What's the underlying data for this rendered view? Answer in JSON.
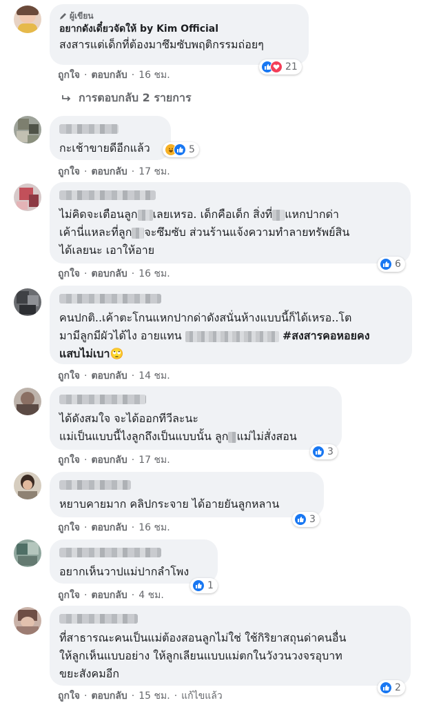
{
  "labels": {
    "like": "ถูกใจ",
    "reply": "ตอบกลับ",
    "dot": "·",
    "edited": "แก้ไขแล้ว"
  },
  "colors": {
    "like": "#1877f2",
    "love": "#f33e58",
    "haha": "#f7b125",
    "bubble": "#f0f2f5",
    "meta": "#65676b"
  },
  "comments": [
    {
      "badge": "ผู้เขียน",
      "author": "อยากดังเดี๋ยวจัดให้ by Kim Official",
      "text": "สงสารแต่เด็กที่ต้องมาซึมซับพฤติกรรมถ่อยๆ",
      "time": "16 ชม.",
      "reaction_icons": [
        "like-icon",
        "love-icon"
      ],
      "reaction_count": "21",
      "replies_label": "การตอบกลับ 2 รายการ"
    },
    {
      "text": "กะเช้าขายดีอีกแล้ว",
      "time": "17 ชม.",
      "reaction_icons": [
        "haha-icon",
        "like-icon"
      ],
      "reaction_count": "5"
    },
    {
      "line1_a": "ไม่คิดจะเตือนลูก",
      "line1_b": "เลยเหรอ. เด็กคือเด็ก สิ่งที่",
      "line1_c": "แหกปากด่า",
      "line2_a": "เค้านี่แหละที่ลูก",
      "line2_b": "จะซึมซับ ส่วนร้านแจ้งความทำลายทรัพย์สิน",
      "line3": "ได้เลยนะ เอาให้อาย",
      "time": "16 ชม.",
      "reaction_icons": [
        "like-icon"
      ],
      "reaction_count": "6"
    },
    {
      "line1": "คนปกติ..เค้าตะโกนแหกปากด่าดังสนั่นห้างแบบนี้ก็ได้เหรอ..โต",
      "line2_a": "มามีลูกมีผัวได้ไง อายแทน",
      "line2_tag": "#สงสารคอหอยคง",
      "line3": "แสบไม่เบา",
      "emoji": "🙄",
      "time": "14 ชม."
    },
    {
      "line1": "ได้ดังสมใจ จะได้ออกทีวีละนะ",
      "line2_a": "แม่เป็นแบบนี้ไงลูกถึงเป็นแบบนั้น ลูก",
      "line2_b": "แม่ไม่สั่งสอน",
      "time": "17 ชม.",
      "reaction_icons": [
        "like-icon"
      ],
      "reaction_count": "3"
    },
    {
      "text": "หยาบคายมาก คลิปกระจาย ได้อายยันลูกหลาน",
      "time": "16 ชม.",
      "reaction_icons": [
        "like-icon"
      ],
      "reaction_count": "3"
    },
    {
      "text": "อยากเห็นวาปแม่ปากลำโพง",
      "time": "4 ชม.",
      "reaction_icons": [
        "like-icon"
      ],
      "reaction_count": "1"
    },
    {
      "line1": "ที่สาธารณะคนเป็นแม่ต้องสอนลูกไม่ใช่ ใช้กิริยาสถุนด่าคนอื่น",
      "line2": "ให้ลูกเห็นแบบอย่าง ให้ลูกเลียนแบบแม่ตกในวังวนวงจรอุบาท",
      "line3": "ขยะสังคมอีก",
      "time": "15 ชม.",
      "reaction_icons": [
        "like-icon"
      ],
      "reaction_count": "2"
    }
  ]
}
